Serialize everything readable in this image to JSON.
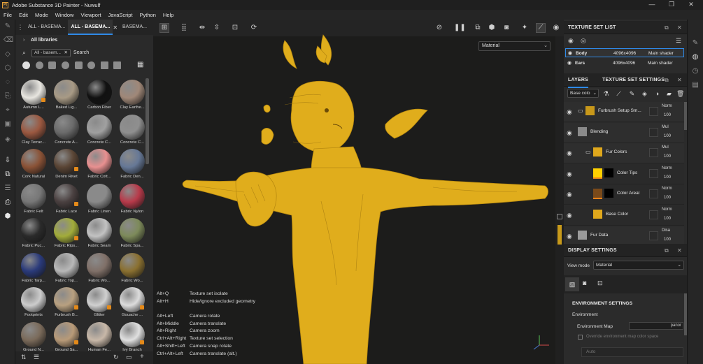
{
  "window": {
    "title": "Adobe Substance 3D Painter - Nuwulf",
    "logo": "Pt",
    "controls": [
      "minimize-icon",
      "maximize-icon",
      "close-icon"
    ]
  },
  "menu": [
    "File",
    "Edit",
    "Mode",
    "Window",
    "Viewport",
    "JavaScript",
    "Python",
    "Help"
  ],
  "shelf": {
    "tabs": [
      "ALL - BASEMA...",
      "ALL - BASEMA...",
      "BASEMA..."
    ],
    "library": "All libraries",
    "search_chip": "All - basem...",
    "search_placeholder": "Search",
    "materials": [
      "Autumn L...",
      "Baked Lig...",
      "Carbon Fiber",
      "Clay Earthe...",
      "Clay Terrac...",
      "Concrete A...",
      "Concrete C...",
      "Concrete C...",
      "Cork Natural",
      "Denim Rivet",
      "Fabric Cott...",
      "Fabric Den...",
      "Fabric Felt",
      "Fabric Lace",
      "Fabric Linen",
      "Fabric Nylon",
      "Fabric Puc...",
      "Fabric Rips...",
      "Fabric Seam",
      "Fabric Spa...",
      "Fabric Tarp...",
      "Fabric Top...",
      "Fabric Wo...",
      "Fabric Wo...",
      "Footprints",
      "Furbrush B...",
      "Glitter",
      "Gouache ...",
      "Ground N...",
      "Ground Sa...",
      "Human Fe...",
      "Ivy Branch"
    ],
    "material_colors": [
      "#e8e6e0",
      "#a89a85",
      "#111111",
      "#a08878",
      "#9b5840",
      "#6a6a6a",
      "#a0a0a0",
      "#8f8f8f",
      "#8a5236",
      "#5a4535",
      "#e89090",
      "#667896",
      "#777777",
      "#4a4040",
      "#8a8a8a",
      "#b83a4a",
      "#2a2a2a",
      "#a2ac3a",
      "#c2c2c2",
      "#7d8a5a",
      "#2a3a7a",
      "#b8b8b8",
      "#807068",
      "#8a7030",
      "#cccccc",
      "#b8a080",
      "#d0d0d0",
      "#dcdcdc",
      "#7a6a5a",
      "#b89a78",
      "#c8b8a8",
      "#e0e0e0"
    ]
  },
  "viewport": {
    "mode_select": "Material",
    "shortcuts": [
      {
        "key": "Alt+Q",
        "desc": "Texture set isolate"
      },
      {
        "key": "Alt+H",
        "desc": "Hide/ignore excluded geometry"
      },
      {
        "key": "",
        "desc": ""
      },
      {
        "key": "Alt+Left",
        "desc": "Camera rotate"
      },
      {
        "key": "Alt+Middle",
        "desc": "Camera translate"
      },
      {
        "key": "Alt+Right",
        "desc": "Camera zoom"
      },
      {
        "key": "Ctrl+Alt+Right",
        "desc": "Texture set selection"
      },
      {
        "key": "Alt+Shift+Left",
        "desc": "Camera snap rotate"
      },
      {
        "key": "Ctrl+Alt+Left",
        "desc": "Camera translate (alt.)"
      }
    ],
    "model_color": "#e5b21c"
  },
  "texture_set_list": {
    "title": "TEXTURE SET LIST",
    "rows": [
      {
        "name": "Body",
        "size": "4096x4096",
        "shader": "Main shader"
      },
      {
        "name": "Ears",
        "size": "4096x4096",
        "shader": "Main shader"
      }
    ]
  },
  "layers": {
    "tab_layers": "LAYERS",
    "tab_settings": "TEXTURE SET SETTINGS",
    "channel_select": "Base colo",
    "items": [
      {
        "name": "Furbrush Setup Sm...",
        "blend": "Norm",
        "opacity": "100"
      },
      {
        "name": "Blending",
        "blend": "Mul",
        "opacity": "100"
      },
      {
        "name": "Fur Colors",
        "blend": "Mul",
        "opacity": "100"
      },
      {
        "name": "Color Tips",
        "blend": "Norm",
        "opacity": "100"
      },
      {
        "name": "Color Areal",
        "blend": "Norm",
        "opacity": "100"
      },
      {
        "name": "Base Color",
        "blend": "Norm",
        "opacity": "100"
      },
      {
        "name": "Fur Data",
        "blend": "Disa",
        "opacity": "100"
      }
    ]
  },
  "display_settings": {
    "title": "DISPLAY SETTINGS",
    "view_mode_label": "View mode",
    "view_mode_value": "Material",
    "env_title": "ENVIRONMENT SETTINGS",
    "env_label": "Environment",
    "env_map_label": "Environment Map",
    "env_map_value": "panor",
    "override_label": "Override environment map color space",
    "auto_value": "Auto"
  }
}
